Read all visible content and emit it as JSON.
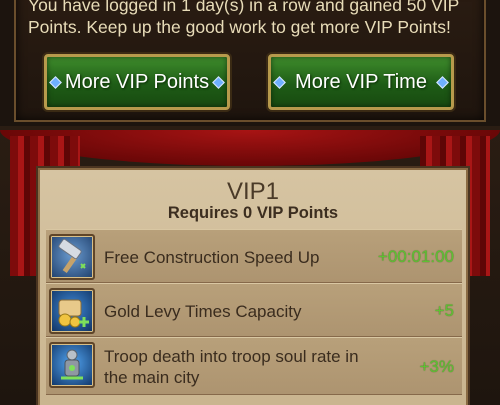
{
  "header": {
    "message": "You have logged in 1 day(s) in a row and gained 50 VIP Points.  Keep up the good work to get more VIP Points!"
  },
  "buttons": {
    "more_points": "More VIP Points",
    "more_time": "More VIP Time"
  },
  "vip": {
    "level": "VIP1",
    "requirement": "Requires 0 VIP Points",
    "perks": [
      {
        "icon": "hammer-icon",
        "label": "Free Construction Speed Up",
        "value": "+00:01:00"
      },
      {
        "icon": "gold-levy-icon",
        "label": "Gold Levy Times Capacity",
        "value": "+5"
      },
      {
        "icon": "troop-soul-icon",
        "label": "Troop death into troop soul rate in the main city",
        "value": "+3%"
      }
    ]
  },
  "colors": {
    "accent_green": "#5fc034",
    "button_green": "#2e7a20",
    "curtain_red": "#a81414",
    "parchment": "#d6c4a2"
  }
}
